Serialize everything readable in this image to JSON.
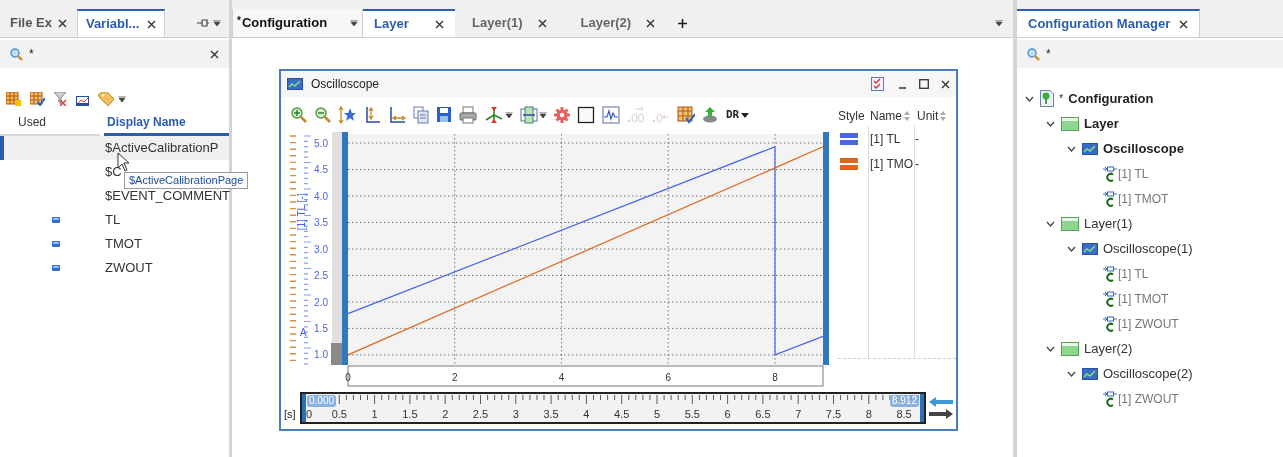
{
  "left_panel": {
    "tabs": [
      {
        "label": "File Ex",
        "selected": false
      },
      {
        "label": "Variabl...",
        "selected": true
      }
    ],
    "search": {
      "value": "*"
    },
    "columns": [
      "Used",
      "Display Name"
    ],
    "rows": [
      {
        "name": "$ActiveCalibrationP",
        "used": false,
        "selected": true
      },
      {
        "name": "$C",
        "used": false,
        "selected": false
      },
      {
        "name": "$EVENT_COMMENT",
        "used": false,
        "selected": false
      },
      {
        "name": "TL",
        "used": true,
        "selected": false
      },
      {
        "name": "TMOT",
        "used": true,
        "selected": false
      },
      {
        "name": "ZWOUT",
        "used": true,
        "selected": false
      }
    ],
    "tooltip": "$ActiveCalibrationPage"
  },
  "editor": {
    "tabs": [
      {
        "label": "Configuration",
        "modified": true,
        "selected": false
      },
      {
        "label": "Layer",
        "modified": false,
        "selected": true
      },
      {
        "label": "Layer(1)",
        "modified": false,
        "selected": false
      },
      {
        "label": "Layer(2)",
        "modified": false,
        "selected": false
      }
    ],
    "window": {
      "title": "Oscilloscope",
      "toolbar": [
        {
          "kind": "zoom_in",
          "disabled": false
        },
        {
          "kind": "zoom_out",
          "disabled": false
        },
        {
          "kind": "axis_star",
          "disabled": false
        },
        {
          "kind": "y_axis",
          "disabled": false
        },
        {
          "kind": "xy_axis",
          "disabled": false
        },
        {
          "kind": "copy",
          "disabled": false
        },
        {
          "kind": "save",
          "disabled": false
        },
        {
          "kind": "print",
          "disabled": false
        },
        {
          "kind": "cursor",
          "disabled": false
        },
        {
          "kind": "fit",
          "disabled": false
        },
        {
          "kind": "gear",
          "disabled": false
        },
        {
          "kind": "square",
          "disabled": false
        },
        {
          "kind": "wave",
          "disabled": false
        },
        {
          "kind": "decimals_more",
          "disabled": true
        },
        {
          "kind": "decimals_less",
          "disabled": true
        },
        {
          "kind": "table",
          "disabled": false
        },
        {
          "kind": "export",
          "disabled": false
        },
        {
          "kind": "menu",
          "label": "DR",
          "disabled": false
        }
      ],
      "chart_data": {
        "type": "line",
        "ylabel": "[1] TL [-]",
        "x": [
          0,
          8,
          8,
          8.9
        ],
        "series": [
          {
            "name": "[1] TL",
            "color": "#4a64e6",
            "values": [
              1.78,
              4.93,
              1.0,
              1.35
            ]
          },
          {
            "name": "[1] TMO",
            "color": "#e0661e",
            "values": [
              1.0,
              4.53,
              4.53,
              4.93
            ]
          }
        ],
        "grid": true,
        "xlim": [
          0,
          8.9
        ],
        "ylim": [
          0.81,
          5.17
        ],
        "xticks": [
          0,
          2,
          4,
          6,
          8
        ],
        "yticks": [
          {
            "value": 1,
            "label": "1.0"
          },
          {
            "value": 1.5,
            "label": "1.5"
          },
          {
            "value": 2,
            "label": "2.0"
          },
          {
            "value": 2.5,
            "label": "2.5"
          },
          {
            "value": 3,
            "label": "3.0"
          },
          {
            "value": 3.5,
            "label": "3.5"
          },
          {
            "value": 4,
            "label": "4.0"
          },
          {
            "value": 4.5,
            "label": "4.5"
          },
          {
            "value": 5,
            "label": "5.0"
          }
        ]
      },
      "axis_marker": "A",
      "legend": {
        "columns": [
          "Style",
          "Name",
          "Unit"
        ],
        "rows": [
          {
            "unit": "-"
          },
          {
            "unit": "-"
          }
        ]
      },
      "time_axis": {
        "unit": "[s]",
        "start": "0.000",
        "end": "8.912",
        "level": 1,
        "labels": [
          "0",
          "0.5",
          "1",
          "1.5",
          "2",
          "2.5",
          "3",
          "3.5",
          "4",
          "4.5",
          "5",
          "5.5",
          "6",
          "6.5",
          "7",
          "7.5",
          "8",
          "8.5"
        ]
      }
    }
  },
  "config_manager": {
    "tab": "Configuration Manager",
    "search": {
      "value": "*"
    },
    "tree": [
      {
        "kind": "configuration",
        "label": "Configuration",
        "modified": true,
        "active": true,
        "expanded": true,
        "children": [
          {
            "kind": "layer",
            "label": "Layer",
            "active": true,
            "expanded": true,
            "children": [
              {
                "kind": "oscilloscope",
                "label": "Oscilloscope",
                "active": true,
                "expanded": true,
                "children": [
                  {
                    "kind": "signal",
                    "label": "[1] TL"
                  },
                  {
                    "kind": "signal",
                    "label": "[1] TMOT"
                  }
                ]
              }
            ]
          },
          {
            "kind": "layer",
            "label": "Layer(1)",
            "active": false,
            "expanded": true,
            "children": [
              {
                "kind": "oscilloscope",
                "label": "Oscilloscope(1)",
                "active": false,
                "expanded": true,
                "children": [
                  {
                    "kind": "signal",
                    "label": "[1] TL"
                  },
                  {
                    "kind": "signal",
                    "label": "[1] TMOT"
                  },
                  {
                    "kind": "signal",
                    "label": "[1] ZWOUT"
                  }
                ]
              }
            ]
          },
          {
            "kind": "layer",
            "label": "Layer(2)",
            "active": false,
            "expanded": true,
            "children": [
              {
                "kind": "oscilloscope",
                "label": "Oscilloscope(2)",
                "active": false,
                "expanded": true,
                "children": [
                  {
                    "kind": "signal",
                    "label": "[1] ZWOUT"
                  }
                ]
              }
            ]
          }
        ]
      }
    ]
  }
}
